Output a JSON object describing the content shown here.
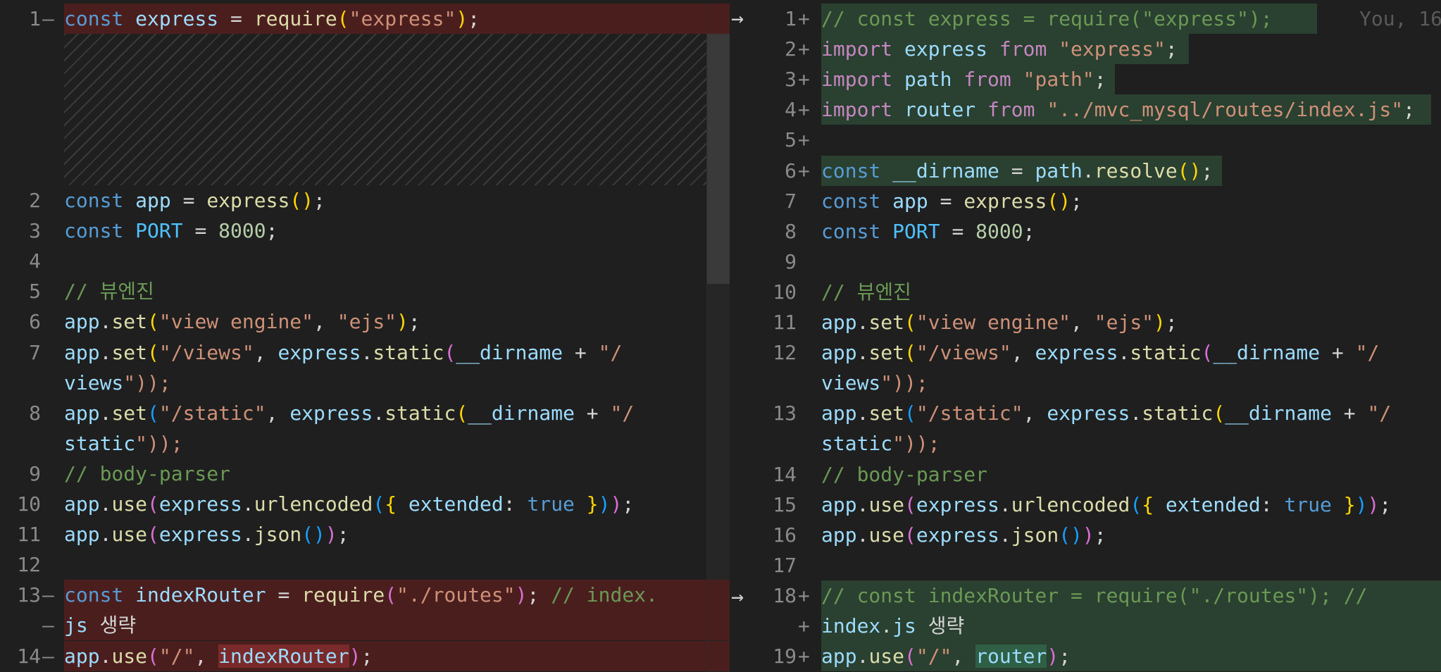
{
  "left": {
    "lines": [
      {
        "n": "1",
        "m": "—",
        "text": "const express = require(\"express\");"
      },
      {
        "n": "2",
        "m": "",
        "text": "const app = express();"
      },
      {
        "n": "3",
        "m": "",
        "text": "const PORT = 8000;"
      },
      {
        "n": "4",
        "m": "",
        "text": ""
      },
      {
        "n": "5",
        "m": "",
        "text": "// 뷰엔진"
      },
      {
        "n": "6",
        "m": "",
        "text": "app.set(\"view engine\", \"ejs\");"
      },
      {
        "n": "7",
        "m": "",
        "text": "app.set(\"/views\", express.static(__dirname + \"/"
      },
      {
        "n": "",
        "m": "",
        "text": "views\"));"
      },
      {
        "n": "8",
        "m": "",
        "text": "app.set(\"/static\", express.static(__dirname + \"/"
      },
      {
        "n": "",
        "m": "",
        "text": "static\"));"
      },
      {
        "n": "9",
        "m": "",
        "text": "// body-parser"
      },
      {
        "n": "10",
        "m": "",
        "text": "app.use(express.urlencoded({ extended: true }));"
      },
      {
        "n": "11",
        "m": "",
        "text": "app.use(express.json());"
      },
      {
        "n": "12",
        "m": "",
        "text": ""
      },
      {
        "n": "13",
        "m": "—",
        "text": "const indexRouter = require(\"./routes\"); // index."
      },
      {
        "n": "",
        "m": "—",
        "text": "js 생략"
      },
      {
        "n": "14",
        "m": "—",
        "text": "app.use(\"/\", indexRouter);"
      }
    ]
  },
  "right": {
    "lines": [
      {
        "n": "1",
        "m": "+",
        "text": "// const express = require(\"express\");"
      },
      {
        "n": "2",
        "m": "+",
        "text": "import express from \"express\";"
      },
      {
        "n": "3",
        "m": "+",
        "text": "import path from \"path\";"
      },
      {
        "n": "4",
        "m": "+",
        "text": "import router from \"../mvc_mysql/routes/index.js\";"
      },
      {
        "n": "5",
        "m": "+",
        "text": ""
      },
      {
        "n": "6",
        "m": "+",
        "text": "const __dirname = path.resolve();"
      },
      {
        "n": "7",
        "m": "",
        "text": "const app = express();"
      },
      {
        "n": "8",
        "m": "",
        "text": "const PORT = 8000;"
      },
      {
        "n": "9",
        "m": "",
        "text": ""
      },
      {
        "n": "10",
        "m": "",
        "text": "// 뷰엔진"
      },
      {
        "n": "11",
        "m": "",
        "text": "app.set(\"view engine\", \"ejs\");"
      },
      {
        "n": "12",
        "m": "",
        "text": "app.set(\"/views\", express.static(__dirname + \"/"
      },
      {
        "n": "",
        "m": "",
        "text": "views\"));"
      },
      {
        "n": "13",
        "m": "",
        "text": "app.set(\"/static\", express.static(__dirname + \"/"
      },
      {
        "n": "",
        "m": "",
        "text": "static\"));"
      },
      {
        "n": "14",
        "m": "",
        "text": "// body-parser"
      },
      {
        "n": "15",
        "m": "",
        "text": "app.use(express.urlencoded({ extended: true }));"
      },
      {
        "n": "16",
        "m": "",
        "text": "app.use(express.json());"
      },
      {
        "n": "17",
        "m": "",
        "text": ""
      },
      {
        "n": "18",
        "m": "+",
        "text": "// const indexRouter = require(\"./routes\"); //"
      },
      {
        "n": "",
        "m": "+",
        "text": "index.js 생략"
      },
      {
        "n": "19",
        "m": "+",
        "text": "app.use(\"/\", router);"
      }
    ],
    "blame": "You, 16"
  },
  "arrow_glyph": "→",
  "colors": {
    "removed_bg": "#4b1e1e",
    "added_bg": "#2a4030",
    "editor_bg": "#1f1f1f"
  }
}
